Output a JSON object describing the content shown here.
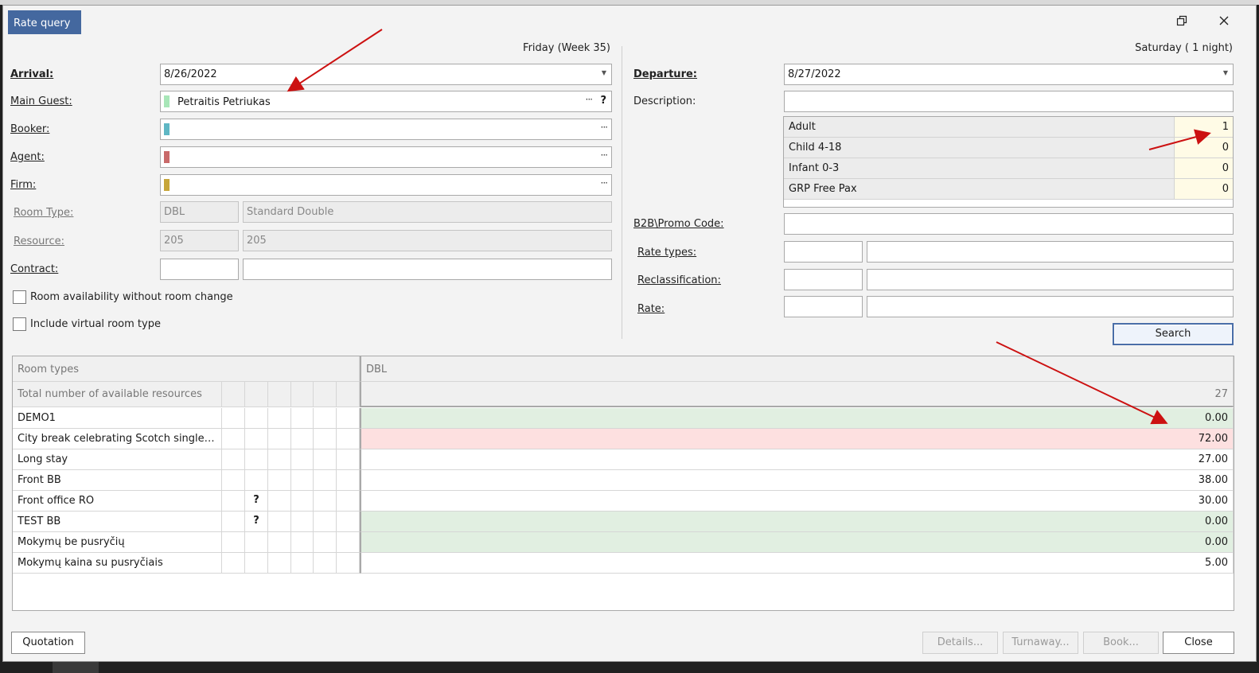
{
  "window": {
    "title": "Rate query",
    "restore_icon": "restore-icon",
    "close_icon": "close-icon"
  },
  "arrival": {
    "day_info": "Friday (Week 35)",
    "label": "Arrival:",
    "value": "8/26/2022"
  },
  "departure": {
    "nights_info": "Saturday ( 1 night)",
    "label": "Departure:",
    "value": "8/27/2022"
  },
  "main_guest": {
    "label": "Main Guest:",
    "value": "Petraitis Petriukas",
    "color": "#a8e6b8"
  },
  "booker": {
    "label": "Booker:",
    "value": "",
    "color": "#5fb7c4"
  },
  "agent": {
    "label": "Agent:",
    "value": "",
    "color": "#c96a6a"
  },
  "firm": {
    "label": "Firm:",
    "value": "",
    "color": "#c7a63a"
  },
  "room_type": {
    "label": "Room Type:",
    "code": "DBL",
    "name": "Standard Double"
  },
  "resource": {
    "label": "Resource:",
    "code": "205",
    "name": "205"
  },
  "contract": {
    "label": "Contract:",
    "code": "",
    "name": ""
  },
  "options": {
    "room_availability": "Room availability without room change",
    "include_virtual": "Include virtual room type"
  },
  "description": {
    "label": "Description:",
    "value": ""
  },
  "pax": [
    {
      "name": "Adult",
      "value": "1"
    },
    {
      "name": "Child 4-18",
      "value": "0"
    },
    {
      "name": "Infant 0-3",
      "value": "0"
    },
    {
      "name": "GRP Free Pax",
      "value": "0"
    }
  ],
  "promo": {
    "label": "B2B\\Promo Code:",
    "value": ""
  },
  "rate_types": {
    "label": "Rate types:"
  },
  "reclassification": {
    "label": "Reclassification:"
  },
  "rate": {
    "label": "Rate:"
  },
  "search_label": "Search",
  "grid": {
    "header_left": "Room types",
    "header_right": "DBL",
    "total_label": "Total number of available resources",
    "total_value": "27",
    "rows": [
      {
        "name": "DEMO1",
        "flag": "",
        "value": "0.00",
        "bg": "#e1efe1"
      },
      {
        "name": "City break celebrating Scotch single…",
        "flag": "",
        "value": "72.00",
        "bg": "#fde0e0"
      },
      {
        "name": "Long stay",
        "flag": "",
        "value": "27.00",
        "bg": "#ffffff"
      },
      {
        "name": "Front BB",
        "flag": "",
        "value": "38.00",
        "bg": "#ffffff"
      },
      {
        "name": "Front office RO",
        "flag": "?",
        "value": "30.00",
        "bg": "#ffffff"
      },
      {
        "name": "TEST BB",
        "flag": "?",
        "value": "0.00",
        "bg": "#e1efe1"
      },
      {
        "name": "Mokymų be pusryčių",
        "flag": "",
        "value": "0.00",
        "bg": "#e1efe1"
      },
      {
        "name": "Mokymų kaina su pusryčiais",
        "flag": "",
        "value": "5.00",
        "bg": "#ffffff"
      }
    ]
  },
  "footer": {
    "quotation": "Quotation",
    "details": "Details...",
    "turnaway": "Turnaway...",
    "book": "Book...",
    "close": "Close"
  }
}
